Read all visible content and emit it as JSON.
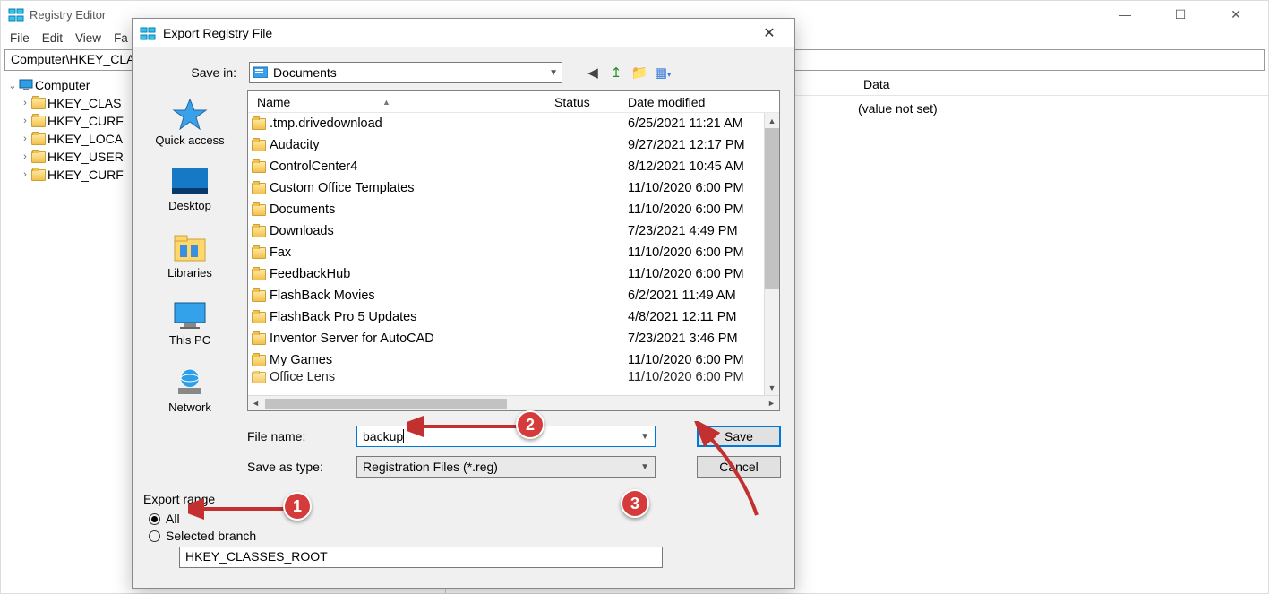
{
  "main": {
    "title": "Registry Editor",
    "menu": [
      "File",
      "Edit",
      "View",
      "Fa"
    ],
    "address": "Computer\\HKEY_CLAS",
    "tree": {
      "root": "Computer",
      "keys": [
        "HKEY_CLAS",
        "HKEY_CURF",
        "HKEY_LOCA",
        "HKEY_USER",
        "HKEY_CURF"
      ]
    },
    "col_data": "Data",
    "value_not_set": "(value not set)"
  },
  "dialog": {
    "title": "Export Registry File",
    "save_in_label": "Save in:",
    "save_in_value": "Documents",
    "places": [
      "Quick access",
      "Desktop",
      "Libraries",
      "This PC",
      "Network"
    ],
    "columns": {
      "name": "Name",
      "status": "Status",
      "date": "Date modified"
    },
    "files": [
      {
        "name": ".tmp.drivedownload",
        "date": "6/25/2021 11:21 AM"
      },
      {
        "name": "Audacity",
        "date": "9/27/2021 12:17 PM"
      },
      {
        "name": "ControlCenter4",
        "date": "8/12/2021 10:45 AM"
      },
      {
        "name": "Custom Office Templates",
        "date": "11/10/2020 6:00 PM"
      },
      {
        "name": "Documents",
        "date": "11/10/2020 6:00 PM"
      },
      {
        "name": "Downloads",
        "date": "7/23/2021 4:49 PM"
      },
      {
        "name": "Fax",
        "date": "11/10/2020 6:00 PM"
      },
      {
        "name": "FeedbackHub",
        "date": "11/10/2020 6:00 PM"
      },
      {
        "name": "FlashBack Movies",
        "date": "6/2/2021 11:49 AM"
      },
      {
        "name": "FlashBack Pro 5 Updates",
        "date": "4/8/2021 12:11 PM"
      },
      {
        "name": "Inventor Server for AutoCAD",
        "date": "7/23/2021 3:46 PM"
      },
      {
        "name": "My Games",
        "date": "11/10/2020 6:00 PM"
      },
      {
        "name": "Office Lens",
        "date": "11/10/2020 6:00 PM"
      }
    ],
    "file_name_label": "File name:",
    "file_name_value": "backup",
    "save_as_type_label": "Save as type:",
    "save_as_type_value": "Registration Files (*.reg)",
    "save_button": "Save",
    "cancel_button": "Cancel",
    "export_range_label": "Export range",
    "radio_all": "All",
    "radio_selected": "Selected branch",
    "branch_value": "HKEY_CLASSES_ROOT"
  },
  "annotations": {
    "1": "1",
    "2": "2",
    "3": "3"
  }
}
